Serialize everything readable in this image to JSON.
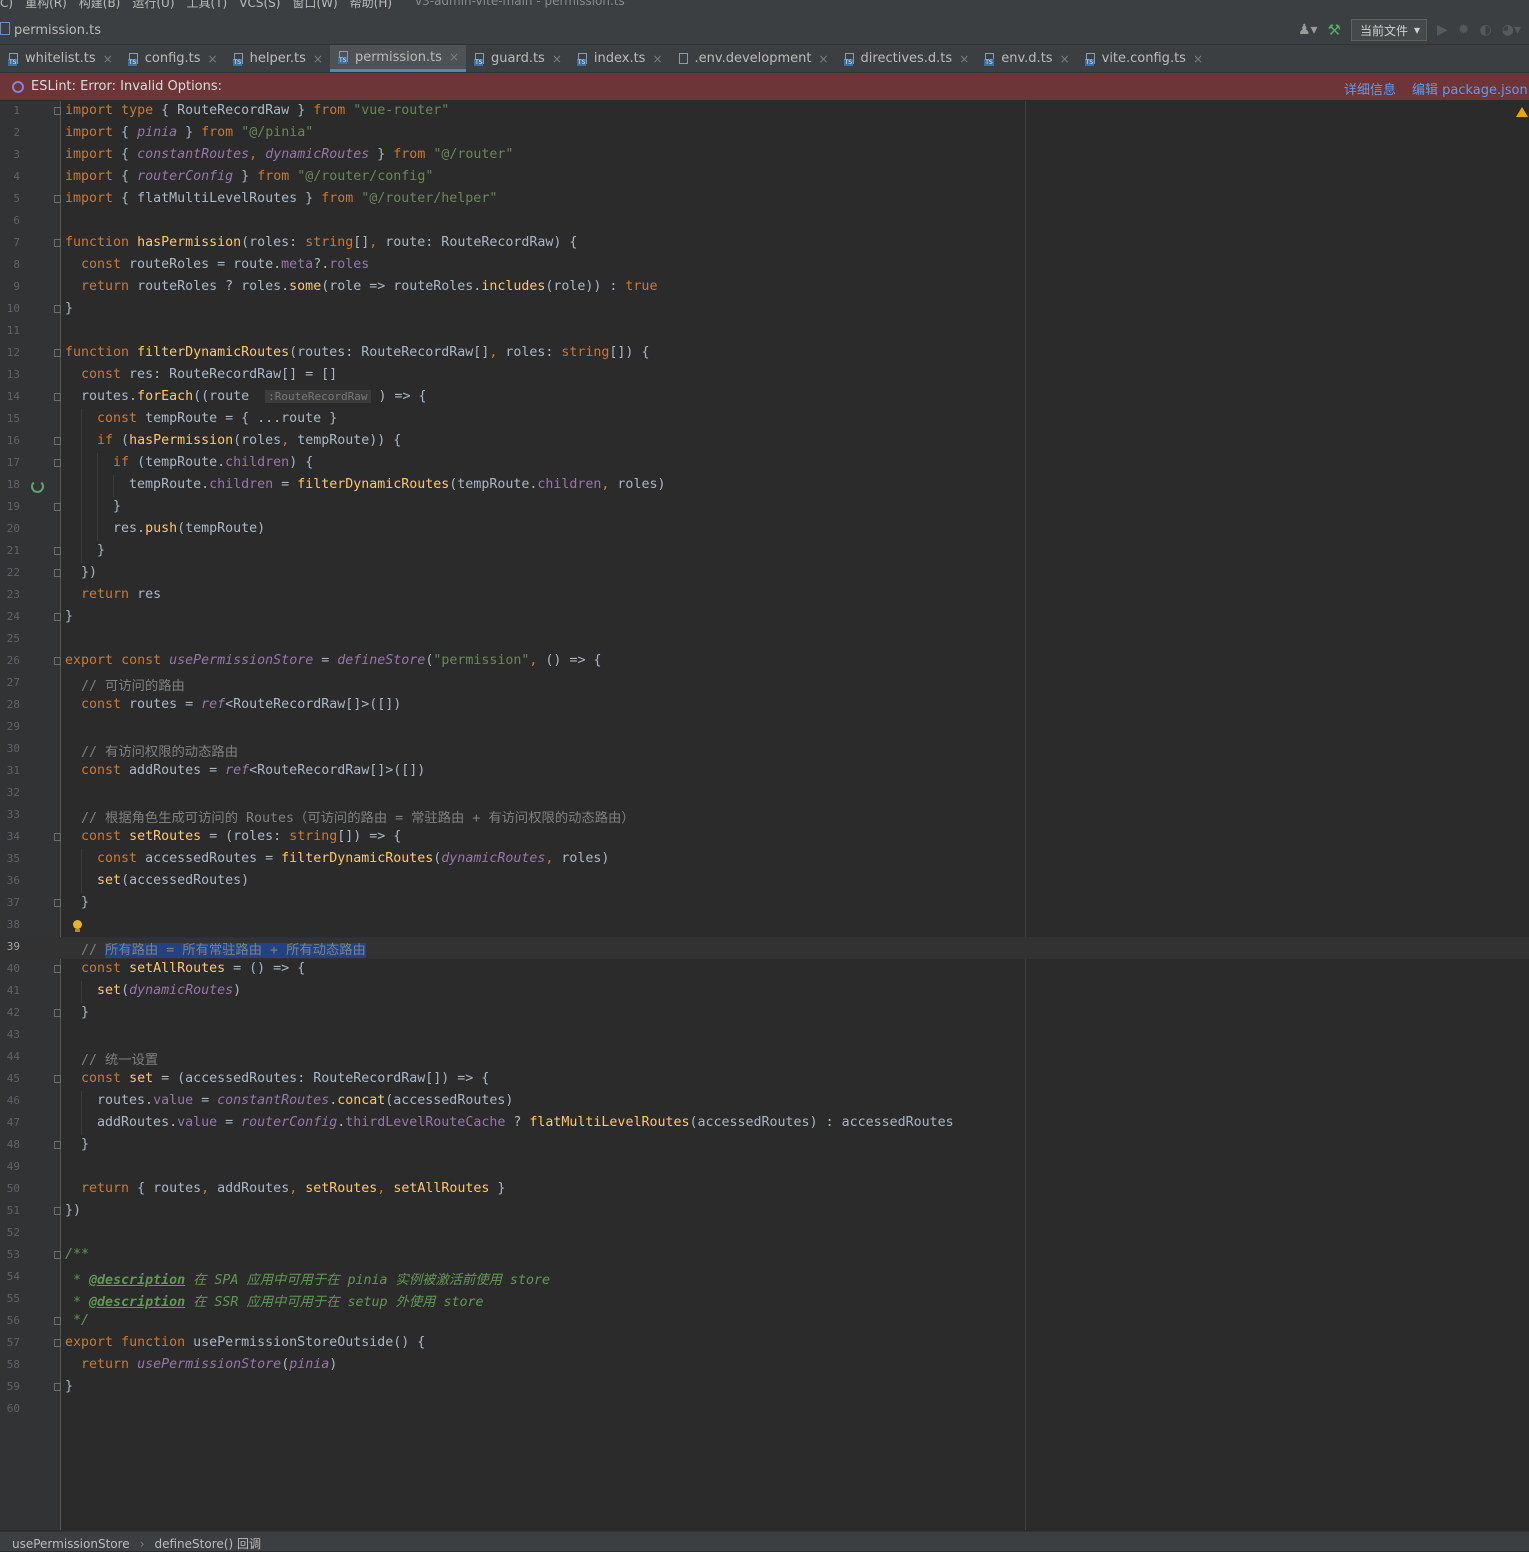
{
  "menu": {
    "items": [
      "C)",
      "重构(R)",
      "构建(B)",
      "运行(U)",
      "工具(T)",
      "VCS(S)",
      "窗口(W)",
      "帮助(H)"
    ],
    "window_title": "v3-admin-vite-main - permission.ts"
  },
  "navbar": {
    "file": "permission.ts",
    "run_config": "当前文件"
  },
  "tabs": [
    {
      "label": "whitelist.ts",
      "type": "ts"
    },
    {
      "label": "config.ts",
      "type": "ts"
    },
    {
      "label": "helper.ts",
      "type": "ts"
    },
    {
      "label": "permission.ts",
      "type": "ts",
      "active": true
    },
    {
      "label": "guard.ts",
      "type": "ts"
    },
    {
      "label": "index.ts",
      "type": "ts"
    },
    {
      "label": ".env.development",
      "type": "env"
    },
    {
      "label": "directives.d.ts",
      "type": "ts"
    },
    {
      "label": "env.d.ts",
      "type": "ts"
    },
    {
      "label": "vite.config.ts",
      "type": "ts"
    }
  ],
  "tab_close_glyph": "×",
  "eslint": {
    "message": "ESLint: Error: Invalid Options:",
    "details_link": "详细信息",
    "edit_link": "编辑 package.json"
  },
  "editor": {
    "current_line": 39,
    "lines": [
      "import type { RouteRecordRaw } from \"vue-router\"",
      "import { pinia } from \"@/pinia\"",
      "import { constantRoutes, dynamicRoutes } from \"@/router\"",
      "import { routerConfig } from \"@/router/config\"",
      "import { flatMultiLevelRoutes } from \"@/router/helper\"",
      "",
      "function hasPermission(roles: string[], route: RouteRecordRaw) {",
      "  const routeRoles = route.meta?.roles",
      "  return routeRoles ? roles.some(role => routeRoles.includes(role)) : true",
      "}",
      "",
      "function filterDynamicRoutes(routes: RouteRecordRaw[], roles: string[]) {",
      "  const res: RouteRecordRaw[] = []",
      "  routes.forEach((route : RouteRecordRaw ) => {",
      "    const tempRoute = { ...route }",
      "    if (hasPermission(roles, tempRoute)) {",
      "      if (tempRoute.children) {",
      "        tempRoute.children = filterDynamicRoutes(tempRoute.children, roles)",
      "      }",
      "      res.push(tempRoute)",
      "    }",
      "  })",
      "  return res",
      "}",
      "",
      "export const usePermissionStore = defineStore(\"permission\", () => {",
      "  // 可访问的路由",
      "  const routes = ref<RouteRecordRaw[]>([])",
      "",
      "  // 有访问权限的动态路由",
      "  const addRoutes = ref<RouteRecordRaw[]>([])",
      "",
      "  // 根据角色生成可访问的 Routes（可访问的路由 = 常驻路由 + 有访问权限的动态路由）",
      "  const setRoutes = (roles: string[]) => {",
      "    const accessedRoutes = filterDynamicRoutes(dynamicRoutes, roles)",
      "    set(accessedRoutes)",
      "  }",
      "",
      "  // 所有路由 = 所有常驻路由 + 所有动态路由",
      "  const setAllRoutes = () => {",
      "    set(dynamicRoutes)",
      "  }",
      "",
      "  // 统一设置",
      "  const set = (accessedRoutes: RouteRecordRaw[]) => {",
      "    routes.value = constantRoutes.concat(accessedRoutes)",
      "    addRoutes.value = routerConfig.thirdLevelRouteCache ? flatMultiLevelRoutes(accessedRoutes) : accessedRoutes",
      "  }",
      "",
      "  return { routes, addRoutes, setRoutes, setAllRoutes }",
      "})",
      "",
      "/**",
      " * @description 在 SPA 应用中可用于在 pinia 实例被激活前使用 store",
      " * @description 在 SSR 应用中可用于在 setup 外使用 store",
      " */",
      "export function usePermissionStoreOutside() {",
      "  return usePermissionStore(pinia)",
      "}",
      ""
    ]
  },
  "status": {
    "crumbs": [
      "usePermissionStore",
      "defineStore() 回调"
    ]
  }
}
